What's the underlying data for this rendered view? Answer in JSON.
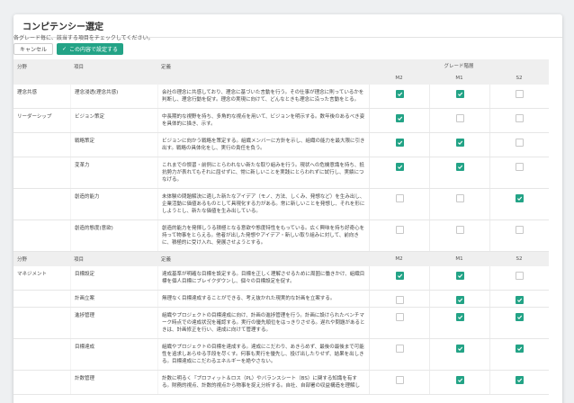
{
  "page": {
    "title": "コンピテンシー選定",
    "instruction": "各グレード毎に、該当する項目をチェックしてください。",
    "cancel_label": "キャンセル",
    "save_label": "この内容で設定する"
  },
  "table": {
    "headers": {
      "category": "分野",
      "item": "項目",
      "definition": "定義",
      "grade_group": "グレード階層",
      "grades": [
        "M2",
        "M1",
        "S2"
      ]
    },
    "sections": [
      {
        "rows": [
          {
            "category": "理念共感",
            "item": "理念浸透(理念共感)",
            "definition": "会社の理念に共感しており、理念に基づいた言動を行う。その仕事が理念に則っているかを判断し、理念行動を促す。理念の実現に向けて、どんなときも理念に沿った言動をとる。",
            "checks": [
              true,
              true,
              false
            ]
          },
          {
            "category": "リーダーシップ",
            "item": "ビジョン策定",
            "definition": "中長期的な視野を持ち、多角的な視点を用いて、ビジョンを明示する。数年後のあるべき姿を具体的に描き、示す。",
            "checks": [
              true,
              false,
              false
            ]
          },
          {
            "category": "",
            "item": "戦略策定",
            "definition": "ビジョンに向かう戦略を策定する。組織メンバーに方針を示し、組織の能力を最大限に引き出す。戦略の具体化をし、実行の責任を負う。",
            "checks": [
              true,
              true,
              false
            ]
          },
          {
            "category": "",
            "item": "変革力",
            "definition": "これまでの慣習・前例にとらわれない新たな取り組みを行う。現状への危機意識を持ち、抵抗勢力が表れてもそれに屈せずに、常に新しいことを実践にとらわれずに試行し、実績につなげる。",
            "checks": [
              true,
              true,
              false
            ]
          },
          {
            "category": "",
            "item": "創造的能力",
            "definition": "未体験の問題解決に適した新たなアイデア（モノ、方法、しくみ、発想など）を生み出し、企業活動に価値あるものとして具現化する力がある。常に新しいことを発想し、それを形にしようとし、新たな価値を生み出している。",
            "checks": [
              false,
              false,
              true
            ]
          },
          {
            "category": "",
            "item": "創造的態度(意欲)",
            "definition": "創造的能力を発揮しうる積極となる意欲や態度特性をもっている。広く興味を持ち好奇心を持って物事をとらえる。他者が出した発想やアイデア・新しい取り組みに対して、前向きに、積極的に受け入れ、発展させようとする。",
            "checks": [
              false,
              false,
              false
            ]
          }
        ]
      },
      {
        "rows": [
          {
            "category": "マネジメント",
            "item": "目標設定",
            "definition": "達成基準が明確な目標を設定する。目標を正しく理解させるために周囲に働きかけ、組織目標を個人目標にブレイクダウンし、個々の目標設定を促す。",
            "checks": [
              true,
              true,
              false
            ]
          },
          {
            "category": "",
            "item": "計画立案",
            "definition": "無理なく目標達成することができる、考え抜かれた現実的な計画を立案する。",
            "checks": [
              false,
              true,
              true
            ]
          },
          {
            "category": "",
            "item": "進捗管理",
            "definition": "組織やプロジェクトの目標達成に向け、計画の進捗管理を行う。計画に設けられたベンチマーク時点での達成状況を確認する。実行の優先順位をはっきりさせる。遅れや問題があるときは、計画修正を行い、達成に向けて管理する。",
            "checks": [
              false,
              true,
              true
            ]
          },
          {
            "category": "",
            "item": "目標達成",
            "definition": "組織やプロジェクトの目標を達成する。達成にこだわり、あきらめず、最後の最後まで可能性を追求しあらゆる手段を尽くす。何事も実行を優先し、投げ出したりせず、結果を出しきる。目標達成にこだわるエネルギーを絶やさない。",
            "checks": [
              false,
              true,
              true
            ]
          },
          {
            "category": "",
            "item": "計数管理",
            "definition": "計数に明るく『プロフィット＆ロス（PL）やバランスシート（BS）に関する知識を有する。財務的視点、計数的視点から物事を捉え分析する。自社、自部署の収益構造を理解し",
            "checks": [
              false,
              true,
              true
            ]
          }
        ]
      }
    ]
  },
  "colors": {
    "accent": "#23a386",
    "header_bg": "#efefef"
  }
}
